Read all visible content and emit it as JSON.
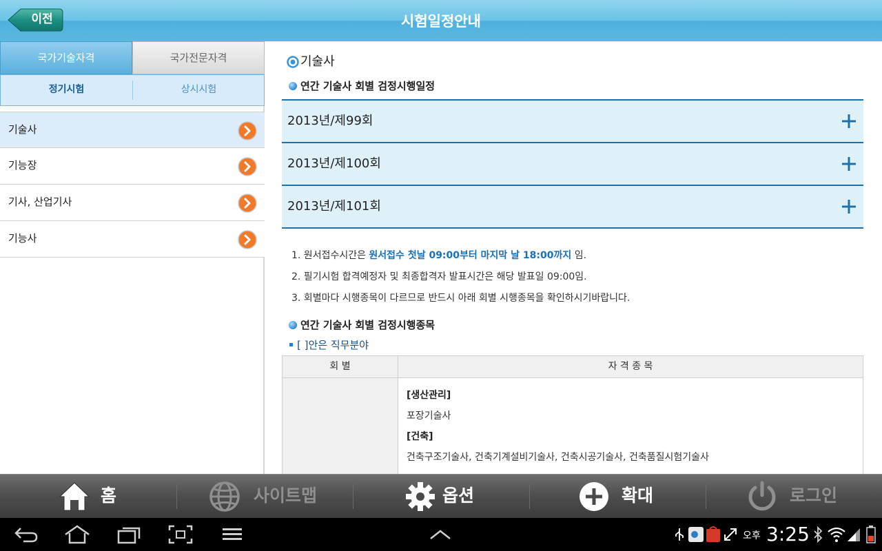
{
  "header": {
    "title": "시험일정안내",
    "back_label": "이전"
  },
  "sidebar": {
    "tabs": [
      {
        "label": "국가기술자격",
        "active": true
      },
      {
        "label": "국가전문자격",
        "active": false
      }
    ],
    "subtabs": [
      {
        "label": "정기시험",
        "active": true
      },
      {
        "label": "상시시험",
        "active": false
      }
    ],
    "items": [
      {
        "label": "기술사",
        "selected": true
      },
      {
        "label": "기능장",
        "selected": false
      },
      {
        "label": "기사, 산업기사",
        "selected": false
      },
      {
        "label": "기능사",
        "selected": false
      }
    ]
  },
  "main": {
    "section_title": "기술사",
    "schedule_title": "연간 기술사 회별 검정시행일정",
    "rounds": [
      {
        "label": "2013년/제99회"
      },
      {
        "label": "2013년/제100회"
      },
      {
        "label": "2013년/제101회"
      }
    ],
    "notes": [
      {
        "prefix": "1. 원서접수시간은 ",
        "highlight": "원서접수 첫날 09:00부터 마지막 날 18:00까지",
        "suffix": " 임."
      },
      {
        "text": "2. 필기시험 합격예정자 및 최종합격자 발표시간은 해당 발표일 09:00임."
      },
      {
        "text": "3. 회별마다 시행종목이 다르므로 반드시 아래 회별 시행종목을 확인하시기바랍니다."
      }
    ],
    "items_title": "연간 기술사 회별 검정시행종목",
    "field_note": "[ ]안은 직무분야",
    "table": {
      "headers": [
        "회 별",
        "자 격 종 목"
      ],
      "rows": [
        {
          "label": "[생산관리]",
          "category": true
        },
        {
          "label": "포장기술사",
          "category": false
        },
        {
          "label": "[건축]",
          "category": true
        },
        {
          "label": "건축구조기술사, 건축기계설비기술사, 건축시공기술사, 건축품질시험기술사",
          "category": false
        }
      ]
    }
  },
  "toolbar": {
    "items": [
      {
        "label": "홈",
        "icon": "home-icon",
        "enabled": true
      },
      {
        "label": "사이트맵",
        "icon": "globe-icon",
        "enabled": false
      },
      {
        "label": "옵션",
        "icon": "gear-icon",
        "enabled": true
      },
      {
        "label": "확대",
        "icon": "zoom-plus-icon",
        "enabled": true
      },
      {
        "label": "로그인",
        "icon": "power-icon",
        "enabled": false
      }
    ]
  },
  "status": {
    "ampm": "오후",
    "time": "3:25"
  },
  "colors": {
    "header": "#5bb8df",
    "accent_blue": "#1f6fa8",
    "accordion_bg": "#dff1f8",
    "arrow_orange": "#f07a2a"
  }
}
